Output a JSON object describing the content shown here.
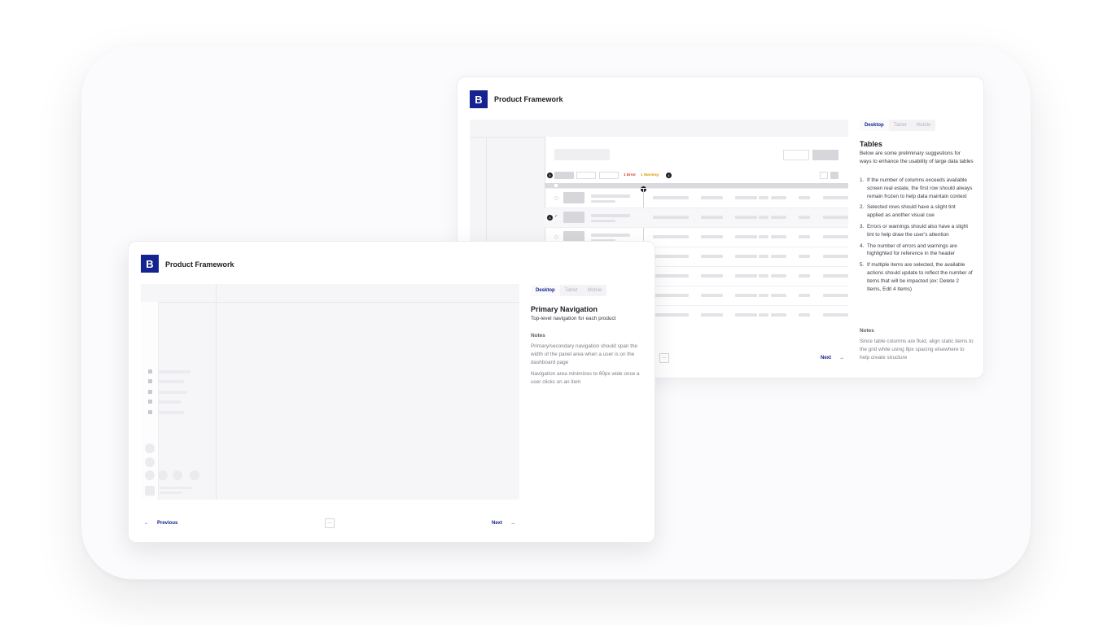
{
  "back_card": {
    "logo_letter": "B",
    "brand": "Product Framework",
    "tabs": [
      "Desktop",
      "Tablet",
      "Mobile"
    ],
    "status": {
      "error": "1 Error",
      "warning": "1 Warning"
    },
    "markers": [
      "6",
      "1",
      "5",
      "4"
    ],
    "title": "Tables",
    "intro": "Below are some preliminary suggestions for ways to enhance the usability of large data tables",
    "items": [
      "If the number of columns exceeds available screen real estate, the first row should always remain frozen to help data maintain context",
      "Selected rows should have a slight tint applied as another visual cue",
      "Errors or warnings should also have a slight tint to help draw the user's attention",
      "The number of errors and warnings are highlighted for reference in the header",
      "If multiple items are selected, the available actions should update to reflect the number of items that will be impacted (ex: Delete 2 Items, Edit 4 Items)"
    ],
    "notes_heading": "Notes",
    "notes": "Since table columns are fluid, align static items to the grid while using 8px spacing elsewhere to help create structure",
    "next_label": "Next",
    "page_btn": "—"
  },
  "front_card": {
    "logo_letter": "B",
    "brand": "Product Framework",
    "tabs": [
      "Desktop",
      "Tablet",
      "Mobile"
    ],
    "title": "Primary Navigation",
    "subtitle": "Top-level navigation for each product",
    "notes_heading": "Notes",
    "notes": [
      "Primary/secondary navigation should span the width of the panel area when a user is on the dashboard page",
      "Navigation area minimizes to 60px wide once a user clicks on an item"
    ],
    "prev_label": "Previous",
    "next_label": "Next",
    "page_btn": "—"
  },
  "colors": {
    "brand": "#14238f",
    "error": "#d0391b",
    "warning": "#d99a00"
  },
  "icons": {
    "arrow_left": "←",
    "arrow_right": "→",
    "check": "✓"
  }
}
